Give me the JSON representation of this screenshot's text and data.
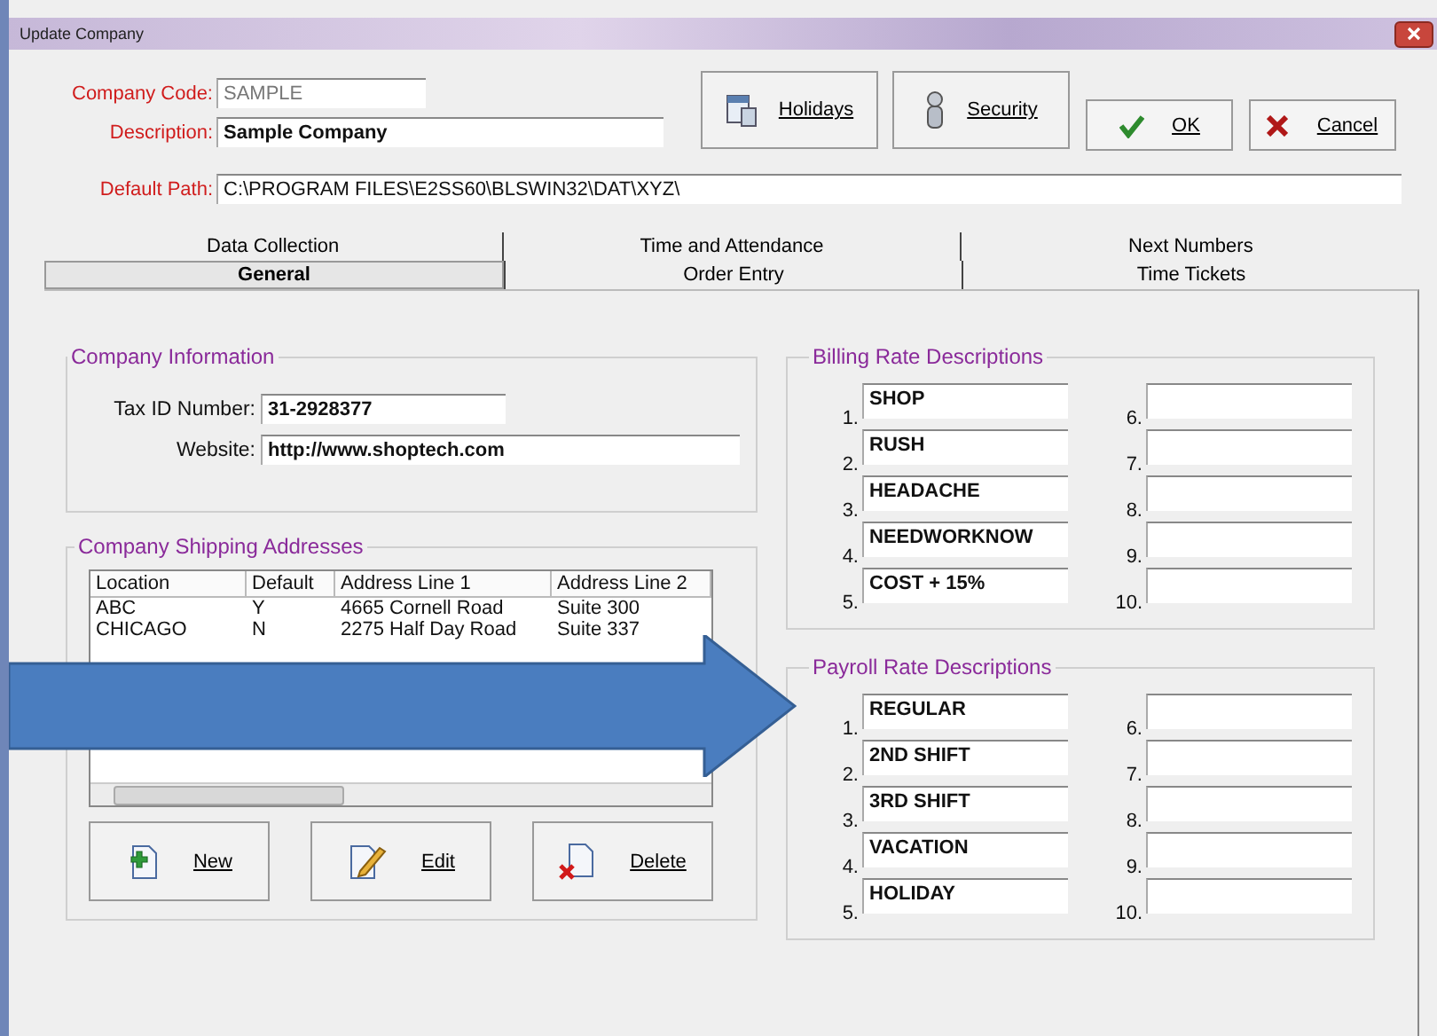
{
  "window": {
    "title": "Update Company"
  },
  "header_fields": [
    {
      "label": "Company Code:",
      "value": "SAMPLE",
      "kind": "readonly"
    },
    {
      "label": "Description:",
      "value": "Sample Company",
      "kind": "bold"
    }
  ],
  "default_path": {
    "label": "Default Path:",
    "value": "C:\\PROGRAM FILES\\E2SS60\\BLSWIN32\\DAT\\XYZ\\"
  },
  "toolbar_buttons": [
    {
      "label": "Holidays",
      "kind": "holidays"
    },
    {
      "label": "Security",
      "kind": "security"
    }
  ],
  "dialog_buttons": [
    {
      "label": "OK",
      "kind": "ok"
    },
    {
      "label": "Cancel",
      "kind": "cancel"
    }
  ],
  "tab_rows": [
    {
      "tabs": [
        {
          "label": "Data Collection",
          "selected": false
        },
        {
          "label": "Time and Attendance",
          "selected": false
        },
        {
          "label": "Next Numbers",
          "selected": false
        }
      ]
    },
    {
      "tabs": [
        {
          "label": "General",
          "selected": true
        },
        {
          "label": "Order Entry",
          "selected": false
        },
        {
          "label": "Time Tickets",
          "selected": false
        }
      ]
    }
  ],
  "company_information": {
    "title": "Company Information",
    "fields": [
      {
        "label": "Tax ID Number:",
        "value": "31-2928377",
        "kind": "short"
      },
      {
        "label": "Website:",
        "value": "http://www.shoptech.com",
        "kind": "long"
      }
    ]
  },
  "shipping_addresses": {
    "title": "Company Shipping Addresses",
    "columns": [
      "Location",
      "Default",
      "Address Line 1",
      "Address Line 2"
    ],
    "rows": [
      [
        "ABC",
        "Y",
        "4665 Cornell Road",
        "Suite 300"
      ],
      [
        "CHICAGO",
        "N",
        "2275 Half Day Road",
        "Suite 337"
      ]
    ],
    "buttons": [
      {
        "label": "New",
        "kind": "new"
      },
      {
        "label": "Edit",
        "kind": "edit"
      },
      {
        "label": "Delete",
        "kind": "delete"
      }
    ]
  },
  "billing_rates": {
    "title": "Billing Rate Descriptions",
    "items": [
      {
        "number": "1.",
        "value": "SHOP"
      },
      {
        "number": "2.",
        "value": "RUSH"
      },
      {
        "number": "3.",
        "value": "HEADACHE"
      },
      {
        "number": "4.",
        "value": "NEEDWORKNOW"
      },
      {
        "number": "5.",
        "value": "COST + 15%"
      },
      {
        "number": "6."
      },
      {
        "number": "7."
      },
      {
        "number": "8."
      },
      {
        "number": "9."
      },
      {
        "number": "10."
      }
    ]
  },
  "payroll_rates": {
    "title": "Payroll Rate Descriptions",
    "items": [
      {
        "number": "1.",
        "value": "REGULAR"
      },
      {
        "number": "2.",
        "value": "2ND SHIFT"
      },
      {
        "number": "3.",
        "value": "3RD SHIFT"
      },
      {
        "number": "4.",
        "value": "VACATION"
      },
      {
        "number": "5.",
        "value": "HOLIDAY"
      },
      {
        "number": "6."
      },
      {
        "number": "7."
      },
      {
        "number": "8."
      },
      {
        "number": "9."
      },
      {
        "number": "10."
      }
    ]
  }
}
